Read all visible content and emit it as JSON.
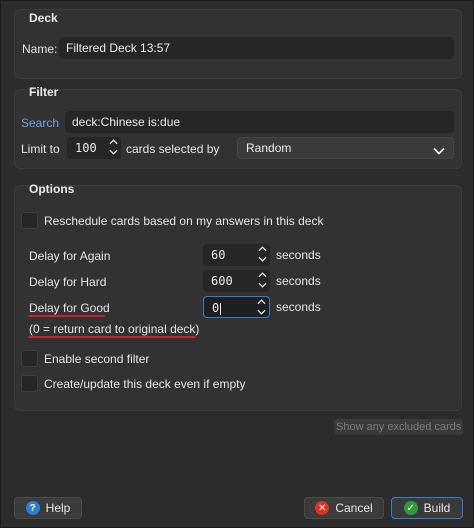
{
  "deck": {
    "title": "Deck",
    "name_label": "Name:",
    "name_value": "Filtered Deck 13:57"
  },
  "filter": {
    "title": "Filter",
    "search_label": "Search",
    "search_value": "deck:Chinese is:due",
    "limit_label": "Limit to",
    "limit_value": "100",
    "cards_selected_label": "cards selected by",
    "order_value": "Random"
  },
  "options": {
    "title": "Options",
    "reschedule_label": "Reschedule cards based on my answers in this deck",
    "delay_again_label": "Delay for Again",
    "delay_again_value": "60",
    "delay_hard_label": "Delay for Hard",
    "delay_hard_value": "600",
    "delay_good_label": "Delay for Good",
    "delay_good_value": "0",
    "seconds_label": "seconds",
    "hint": "(0 = return card to original deck)",
    "second_filter_label": "Enable second filter",
    "create_empty_label": "Create/update this deck even if empty"
  },
  "excluded_link": "Show any excluded cards",
  "buttons": {
    "help": "Help",
    "cancel": "Cancel",
    "build": "Build"
  },
  "colors": {
    "accent": "#2f7fd0",
    "error_underline": "#c8232c",
    "link": "#6fa6d8",
    "cancel_icon": "#d9342b",
    "build_icon": "#2e9a3c",
    "help_icon": "#2f7fd0"
  },
  "icons": {
    "spin_arrows": "chevron-up-down-icon",
    "dropdown": "chevron-down-icon",
    "help": "question-icon",
    "cancel": "x-icon",
    "build": "check-icon"
  }
}
